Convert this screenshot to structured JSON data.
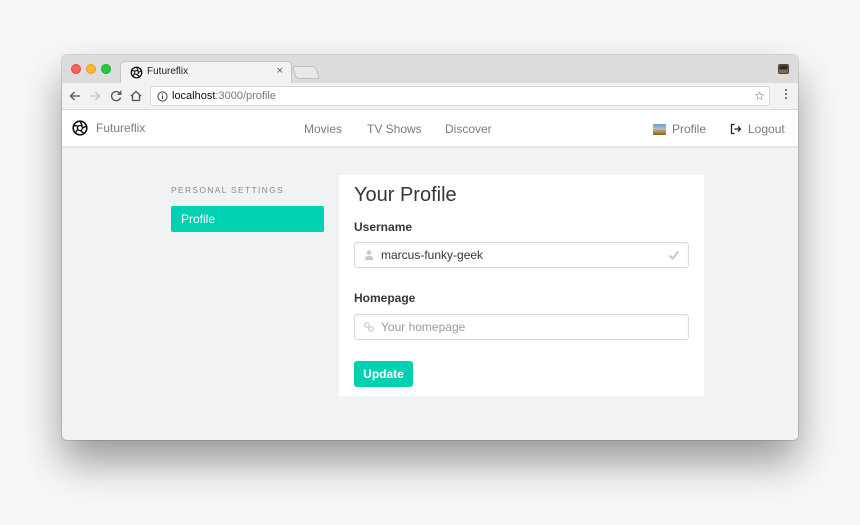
{
  "browser": {
    "tab": {
      "title": "Futureflix",
      "close_glyph": "×",
      "favicon": "aperture-icon"
    },
    "address": {
      "host": "localhost",
      "path": ":3000/profile"
    },
    "icons": [
      "back-icon",
      "forward-icon",
      "reload-icon",
      "home-icon",
      "info-icon",
      "star-icon",
      "menu-icon",
      "extension-icon"
    ],
    "star_glyph": "☆"
  },
  "nav": {
    "brand": "Futureflix",
    "links": [
      {
        "label": "Movies"
      },
      {
        "label": "TV Shows"
      },
      {
        "label": "Discover"
      }
    ],
    "profile_label": "Profile",
    "logout_label": "Logout"
  },
  "sidebar": {
    "heading": "PERSONAL SETTINGS",
    "items": [
      {
        "label": "Profile",
        "active": true
      }
    ]
  },
  "profile_form": {
    "title": "Your Profile",
    "username": {
      "label": "Username",
      "value": "marcus-funky-geek",
      "valid": true
    },
    "homepage": {
      "label": "Homepage",
      "value": "",
      "placeholder": "Your homepage"
    },
    "submit_label": "Update"
  },
  "colors": {
    "accent": "#00d1b2",
    "page_bg": "#f1f2f4",
    "text": "#363636",
    "muted": "#7a7a7a"
  }
}
